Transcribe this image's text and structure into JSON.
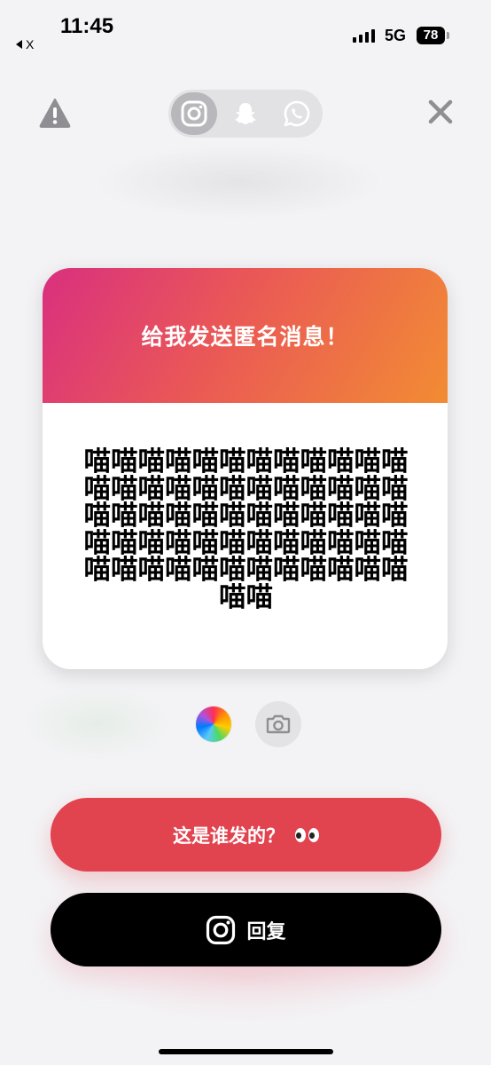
{
  "status_bar": {
    "time": "11:45",
    "back_app": "X",
    "network": "5G",
    "battery": "78"
  },
  "share_options": [
    {
      "name": "instagram",
      "icon": "instagram-icon",
      "active": true
    },
    {
      "name": "snapchat",
      "icon": "snapchat-icon",
      "active": false
    },
    {
      "name": "whatsapp",
      "icon": "whatsapp-icon",
      "active": false
    }
  ],
  "card": {
    "title": "给我发送匿名消息！",
    "message": "喵喵喵喵喵喵喵喵喵喵喵喵喵喵喵喵喵喵喵喵喵喵喵喵喵喵喵喵喵喵喵喵喵喵喵喵喵喵喵喵喵喵喵喵喵喵喵喵喵喵喵喵喵喵喵喵喵喵喵喵喵喵"
  },
  "buttons": {
    "who_sent": "这是谁发的？",
    "reply": "回复"
  },
  "colors": {
    "accent_red": "#e1434f",
    "gradient_start": "#d9307f",
    "gradient_end": "#f28c33",
    "reply_bg": "#000000"
  }
}
